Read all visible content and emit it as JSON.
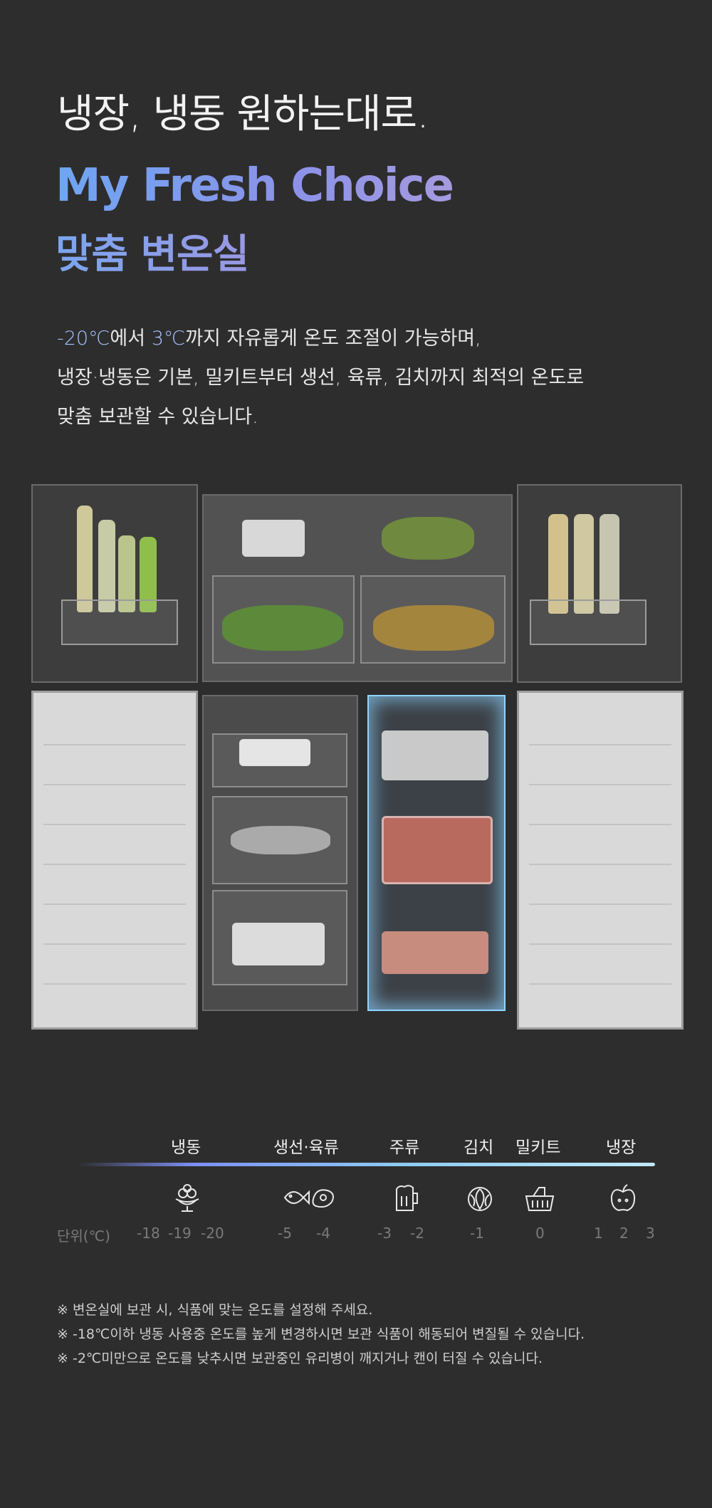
{
  "header": {
    "headline": "냉장, 냉동 원하는대로.",
    "brand": "My Fresh Choice",
    "subbrand": "맞춤 변온실"
  },
  "description": {
    "line1_hl1": "-20℃",
    "line1_mid": "에서 ",
    "line1_hl2": "3℃",
    "line1_rest": "까지 자유롭게 온도 조절이 가능하며,",
    "line2": "냉장·냉동은 기본, 밀키트부터 생선, 육류, 김치까지 최적의 온도로",
    "line3": "맞춤 보관할 수 있습니다."
  },
  "scale": {
    "categories": [
      "냉동",
      "생선·육류",
      "주류",
      "김치",
      "밀키트",
      "냉장"
    ],
    "unit_label": "단위(℃)",
    "ticks": [
      "-18",
      "-19",
      "-20",
      "-5",
      "-4",
      "-3",
      "-2",
      "-1",
      "0",
      "1",
      "2",
      "3"
    ],
    "icons": [
      "ice-cream-icon",
      "fish-meat-icon",
      "beer-icon",
      "cabbage-icon",
      "meal-kit-basket-icon",
      "apple-icon"
    ],
    "gradient_start": "#7d8ff5",
    "gradient_end": "#bfe9f6"
  },
  "notes": [
    "※ 변온실에 보관 시, 식품에 맞는 온도를 설정해 주세요.",
    "※ -18℃이하 냉동 사용중 온도를 높게 변경하시면 보관 식품이 해동되어 변질될 수 있습니다.",
    "※ -2℃미만으로 온도를 낮추시면 보관중인 유리병이 깨지거나 캔이 터질 수 있습니다."
  ],
  "colors": {
    "background": "#2d2d2d",
    "brand_gradient_start": "#6ea6f2",
    "brand_gradient_end": "#a59be0",
    "highlight": "#a9c3ff",
    "light_zone": "#8fd4ff"
  }
}
